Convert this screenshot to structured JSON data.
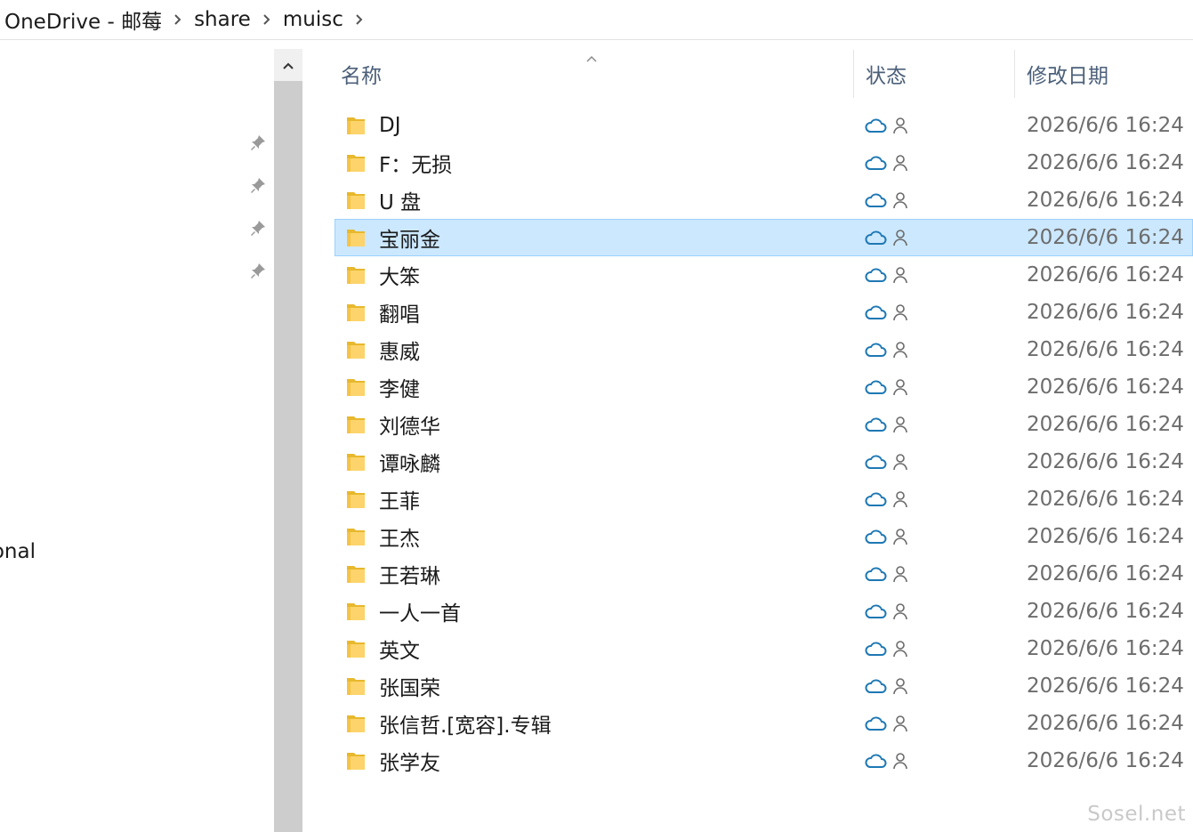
{
  "breadcrumb": {
    "items": [
      "OneDrive - 邮莓",
      "share",
      "muisc"
    ]
  },
  "nav": {
    "partial_label": "onal"
  },
  "columns": {
    "name": "名称",
    "status": "状态",
    "date": "修改日期"
  },
  "colors": {
    "accent": "#cce8ff",
    "cloud": "#1e78b4",
    "header_text": "#4c607a"
  },
  "files": [
    {
      "name": "DJ",
      "date": "2026/6/6 16:24"
    },
    {
      "name": "F：无损",
      "date": "2026/6/6 16:24"
    },
    {
      "name": "U 盘",
      "date": "2026/6/6 16:24"
    },
    {
      "name": "宝丽金",
      "date": "2026/6/6 16:24",
      "selected": true
    },
    {
      "name": "大笨",
      "date": "2026/6/6 16:24"
    },
    {
      "name": "翻唱",
      "date": "2026/6/6 16:24"
    },
    {
      "name": "惠威",
      "date": "2026/6/6 16:24"
    },
    {
      "name": "李健",
      "date": "2026/6/6 16:24"
    },
    {
      "name": "刘德华",
      "date": "2026/6/6 16:24"
    },
    {
      "name": "谭咏麟",
      "date": "2026/6/6 16:24"
    },
    {
      "name": "王菲",
      "date": "2026/6/6 16:24"
    },
    {
      "name": "王杰",
      "date": "2026/6/6 16:24"
    },
    {
      "name": "王若琳",
      "date": "2026/6/6 16:24"
    },
    {
      "name": "一人一首",
      "date": "2026/6/6 16:24"
    },
    {
      "name": "英文",
      "date": "2026/6/6 16:24"
    },
    {
      "name": "张国荣",
      "date": "2026/6/6 16:24"
    },
    {
      "name": "张信哲.[宽容].专辑",
      "date": "2026/6/6 16:24"
    },
    {
      "name": "张学友",
      "date": "2026/6/6 16:24"
    }
  ],
  "watermark": "Sosel.net"
}
